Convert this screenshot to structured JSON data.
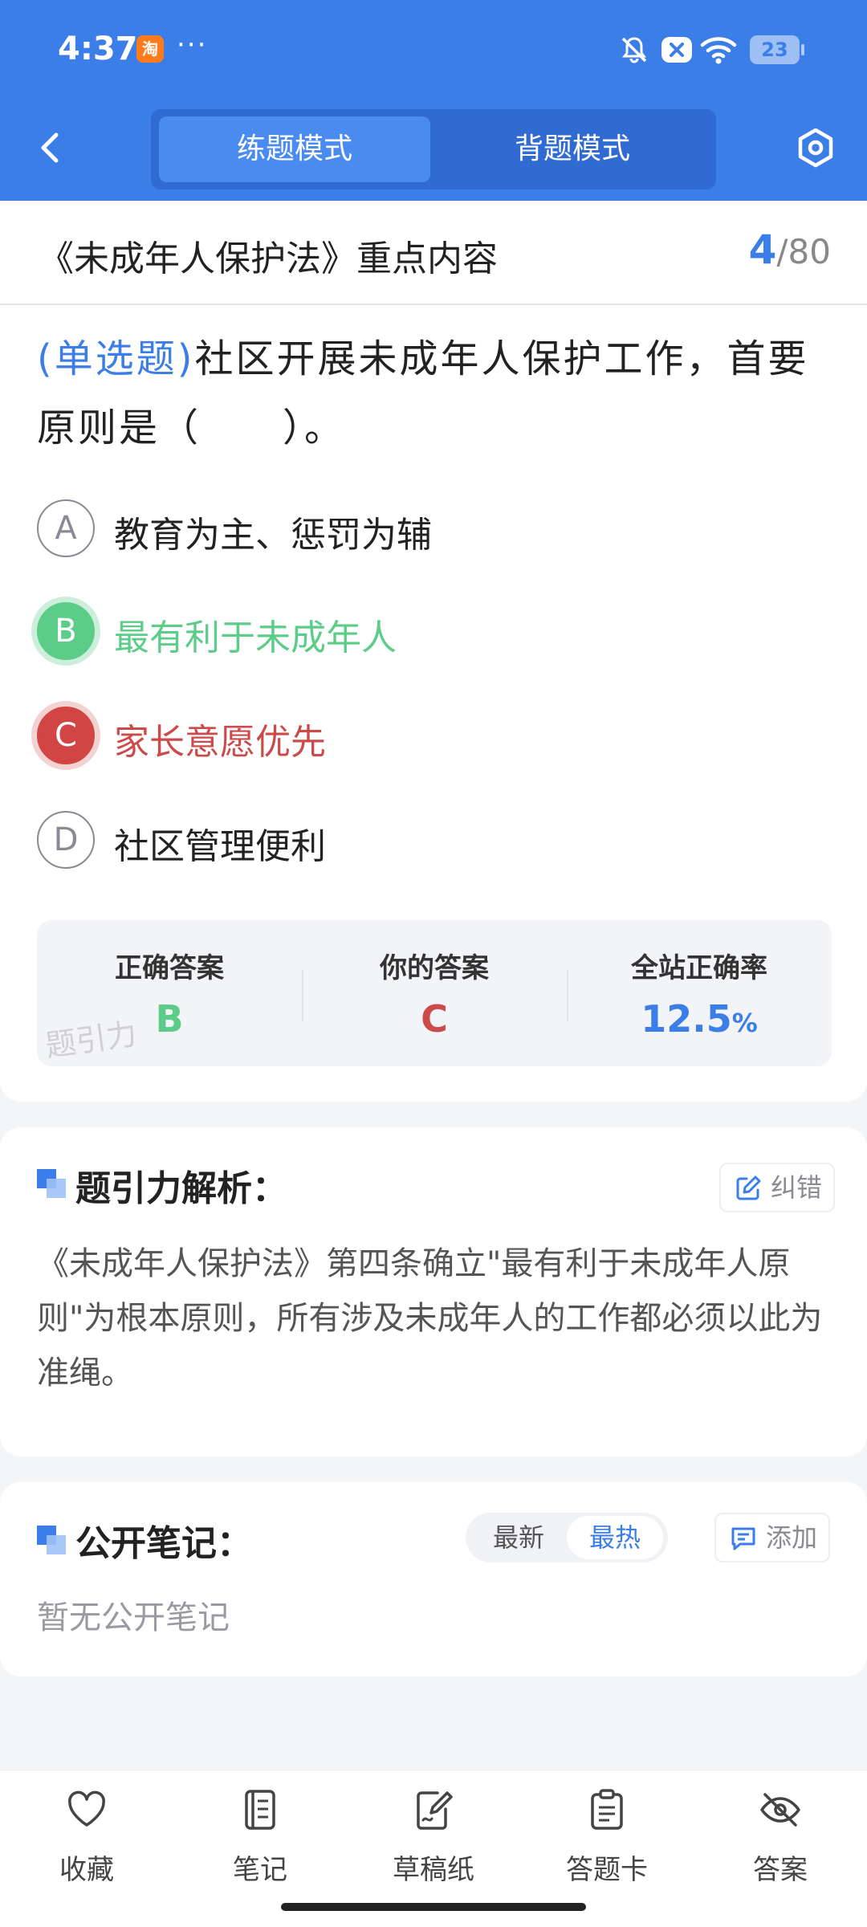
{
  "status_bar": {
    "time": "4:37",
    "taobao_icon_text": "淘",
    "more_dots": "···",
    "battery": "23"
  },
  "header": {
    "mode_practice": "练题模式",
    "mode_memorize": "背题模式"
  },
  "title_bar": {
    "title": "《未成年人保护法》重点内容",
    "current": "4",
    "separator": "/",
    "total": "80"
  },
  "question": {
    "type": "(单选题)",
    "text": "社区开展未成年人保护工作，首要原则是（　　）。",
    "options": [
      {
        "letter": "A",
        "text": "教育为主、惩罚为辅",
        "state": "normal"
      },
      {
        "letter": "B",
        "text": "最有利于未成年人",
        "state": "correct"
      },
      {
        "letter": "C",
        "text": "家长意愿优先",
        "state": "wrong"
      },
      {
        "letter": "D",
        "text": "社区管理便利",
        "state": "normal"
      }
    ]
  },
  "answer_summary": {
    "correct_label": "正确答案",
    "correct_value": "B",
    "yours_label": "你的答案",
    "yours_value": "C",
    "rate_label": "全站正确率",
    "rate_value": "12.5",
    "rate_unit": "%",
    "watermark": "题引力"
  },
  "analysis": {
    "title": "题引力解析：",
    "report_label": "纠错",
    "text": "《未成年人保护法》第四条确立\"最有利于未成年人原则\"为根本原则，所有涉及未成年人的工作都必须以此为准绳。"
  },
  "notes": {
    "title": "公开笔记：",
    "sort_latest": "最新",
    "sort_hot": "最热",
    "add_label": "添加",
    "empty_text": "暂无公开笔记"
  },
  "tabbar": {
    "favorite": "收藏",
    "notes": "笔记",
    "scratch": "草稿纸",
    "answer_card": "答题卡",
    "answer": "答案"
  },
  "colors": {
    "primary": "#3b7ee8",
    "correct": "#5ccc89",
    "wrong": "#d14545"
  }
}
